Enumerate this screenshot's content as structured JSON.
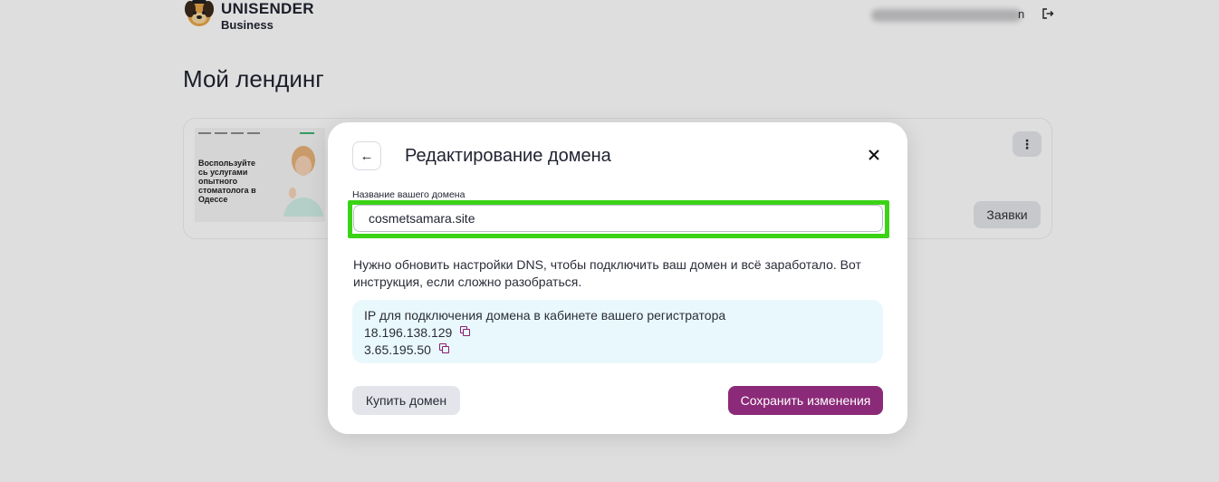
{
  "header": {
    "logo_title": "UNISENDER",
    "logo_subtitle": "Business",
    "user_email_tail": "n",
    "logout_icon": "logout-icon"
  },
  "page": {
    "title": "Мой лендинг"
  },
  "landing_card": {
    "thumbnail_text": "Воспользуйте сь услугами опытного стоматолога в Одессе",
    "menu_icon": "more-vertical-icon",
    "menu_label": "⋮",
    "requests_label": "Заявки"
  },
  "modal": {
    "title": "Редактирование домена",
    "back_icon": "arrow-left-icon",
    "back_label": "←",
    "close_icon": "close-icon",
    "field_label": "Название вашего домена",
    "domain_value": "cosmetsamara.site",
    "dns_note": "Нужно обновить настройки DNS, чтобы подключить ваш домен и всё заработало. Вот инструкция, если сложно разобраться.",
    "ip_box": {
      "heading": "IP для подключения домена в кабинете вашего регистратора",
      "ips": [
        "18.196.138.129",
        "3.65.195.50"
      ],
      "copy_icon": "copy-icon"
    },
    "buy_domain_label": "Купить домен",
    "save_label": "Сохранить изменения"
  },
  "colors": {
    "primary": "#8b2a78",
    "highlight": "#3bd316",
    "ip_box_bg": "#e9f8fd"
  }
}
